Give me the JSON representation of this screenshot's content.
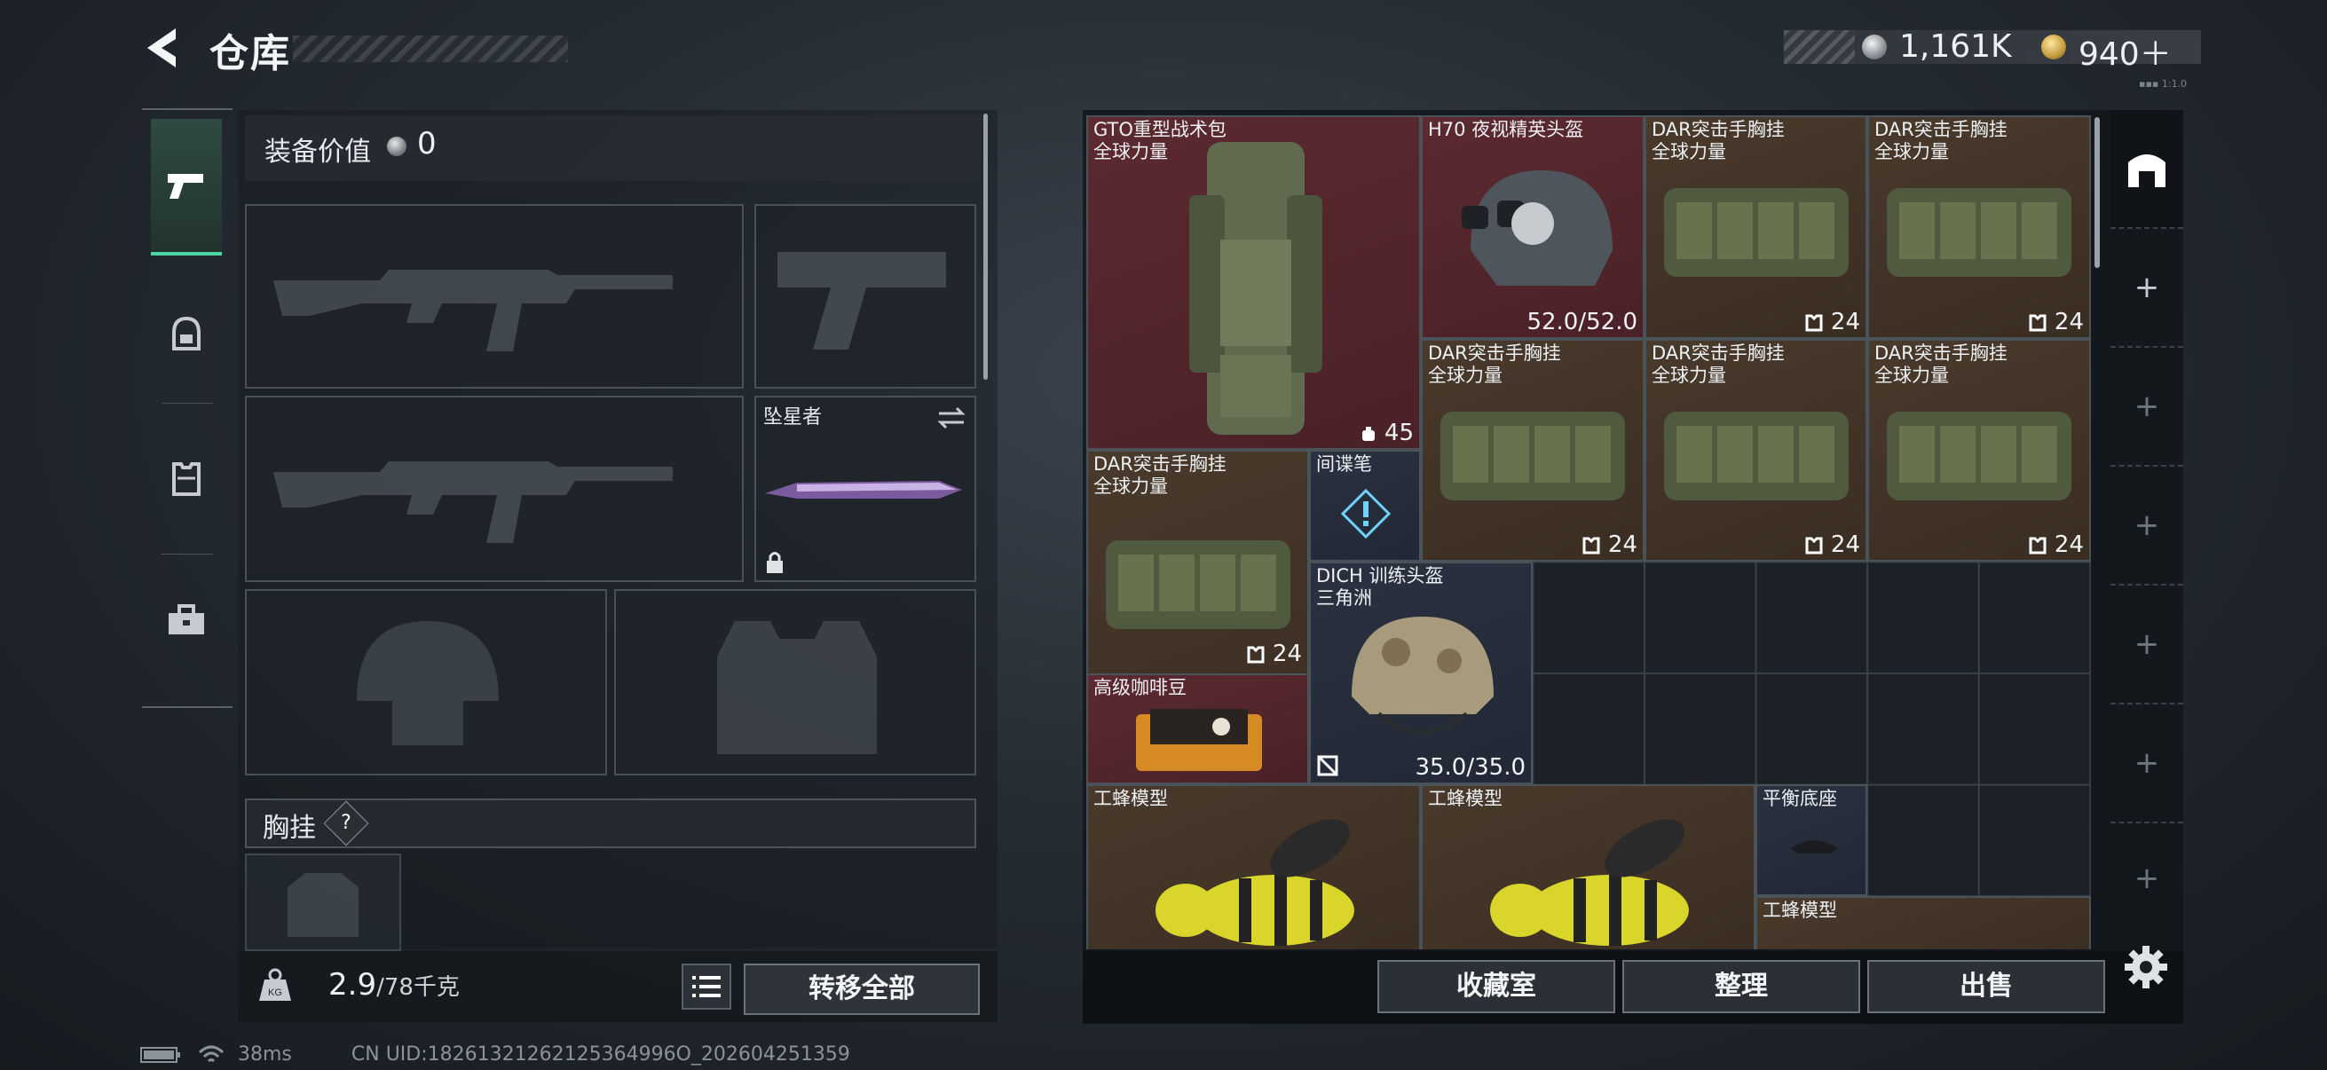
{
  "header": {
    "title": "仓库",
    "currency": [
      {
        "value": "1,161K"
      },
      {
        "value": "940＋"
      }
    ],
    "corner_text": "▪▪▪ 1:1.0"
  },
  "equipment": {
    "label": "装备价值",
    "value": "0"
  },
  "slots": {
    "melee_name": "坠星者",
    "chest_label": "胸挂",
    "chest_help": "?"
  },
  "bottom_left": {
    "weight": "2.9",
    "weight_unit": "/78千克",
    "transfer_all": "转移全部"
  },
  "status": {
    "ping": "38ms",
    "uid": "CN UID:18261321262125364996O_202604251359"
  },
  "inventory": [
    {
      "name": "GTO重型战术包",
      "sub": "全球力量",
      "value": "45"
    },
    {
      "name": "H70 夜视精英头盔",
      "sub": "",
      "value": "52.0/52.0"
    },
    {
      "name": "DAR突击手胸挂",
      "sub": "全球力量",
      "value": "24"
    },
    {
      "name": "DAR突击手胸挂",
      "sub": "全球力量",
      "value": "24"
    },
    {
      "name": "DAR突击手胸挂",
      "sub": "全球力量",
      "value": "24"
    },
    {
      "name": "DAR突击手胸挂",
      "sub": "全球力量",
      "value": "24"
    },
    {
      "name": "DAR突击手胸挂",
      "sub": "全球力量",
      "value": "24"
    },
    {
      "name": "DAR突击手胸挂",
      "sub": "全球力量",
      "value": "24"
    },
    {
      "name": "间谍笔",
      "sub": "",
      "value": ""
    },
    {
      "name": "DICH 训练头盔",
      "sub": "三角洲",
      "value": "35.0/35.0"
    },
    {
      "name": "高级咖啡豆",
      "sub": "",
      "value": ""
    },
    {
      "name": "工蜂模型",
      "sub": "",
      "value": ""
    },
    {
      "name": "工蜂模型",
      "sub": "",
      "value": ""
    },
    {
      "name": "平衡底座",
      "sub": "",
      "value": ""
    },
    {
      "name": "工蜂模型",
      "sub": "",
      "value": ""
    }
  ],
  "bottom_right": {
    "collection": "收藏室",
    "organize": "整理",
    "sell": "出售"
  },
  "colors": {
    "accent": "#4fd4a4",
    "rare_red": "#5c2a30",
    "item_brown": "#4a3a2c"
  }
}
